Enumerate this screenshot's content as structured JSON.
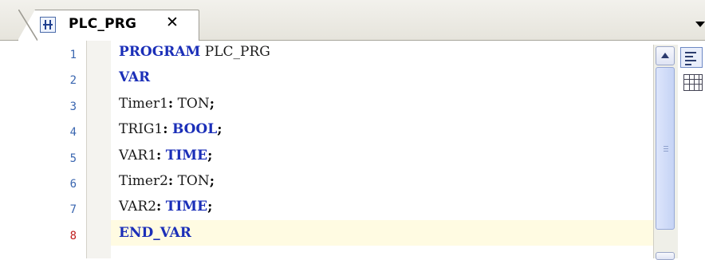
{
  "tab": {
    "title": "PLC_PRG",
    "close_glyph": "✕",
    "icon": "pou-program-icon"
  },
  "editor": {
    "current_line": 8,
    "lines": [
      {
        "number": "1",
        "parts": [
          {
            "t": "PROGRAM",
            "k": "kw"
          },
          {
            "t": " PLC_PRG",
            "k": ""
          }
        ]
      },
      {
        "number": "2",
        "parts": [
          {
            "t": "VAR",
            "k": "kw"
          }
        ]
      },
      {
        "number": "3",
        "parts": [
          {
            "t": "Timer1",
            "k": ""
          },
          {
            "t": ":",
            "k": "op"
          },
          {
            "t": " TON",
            "k": ""
          },
          {
            "t": ";",
            "k": "op"
          }
        ]
      },
      {
        "number": "4",
        "parts": [
          {
            "t": "TRIG1",
            "k": ""
          },
          {
            "t": ":",
            "k": "op"
          },
          {
            "t": " ",
            "k": ""
          },
          {
            "t": "BOOL",
            "k": "kw"
          },
          {
            "t": ";",
            "k": "op"
          }
        ]
      },
      {
        "number": "5",
        "parts": [
          {
            "t": "VAR1",
            "k": ""
          },
          {
            "t": ":",
            "k": "op"
          },
          {
            "t": " ",
            "k": ""
          },
          {
            "t": "TIME",
            "k": "kw"
          },
          {
            "t": ";",
            "k": "op"
          }
        ]
      },
      {
        "number": "6",
        "parts": [
          {
            "t": "Timer2",
            "k": ""
          },
          {
            "t": ":",
            "k": "op"
          },
          {
            "t": " TON",
            "k": ""
          },
          {
            "t": ";",
            "k": "op"
          }
        ]
      },
      {
        "number": "7",
        "parts": [
          {
            "t": "VAR2",
            "k": ""
          },
          {
            "t": ":",
            "k": "op"
          },
          {
            "t": " ",
            "k": ""
          },
          {
            "t": "TIME",
            "k": "kw"
          },
          {
            "t": ";",
            "k": "op"
          }
        ]
      },
      {
        "number": "8",
        "parts": [
          {
            "t": "END_VAR",
            "k": "kw"
          }
        ]
      }
    ]
  },
  "side_buttons": [
    "textual-view-icon",
    "tabular-view-icon"
  ],
  "colors": {
    "keyword": "#1b2fb8",
    "line_number": "#3a66b0",
    "current_line_number": "#c02020",
    "current_line_bg": "#fffbe2"
  }
}
